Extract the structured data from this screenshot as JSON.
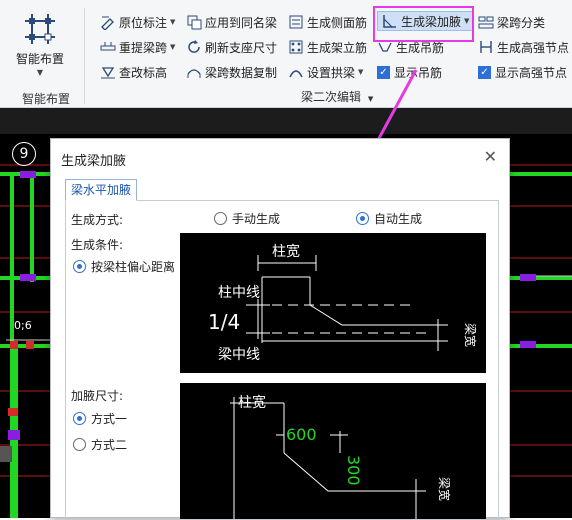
{
  "ribbon": {
    "layout_button": {
      "label": "智能布置",
      "icon": "grid-layout-icon"
    },
    "groups": {
      "layout": "智能布置",
      "beam_edit": "梁二次编辑"
    },
    "col1": [
      {
        "label": "原位标注",
        "icon": "annotate-icon",
        "dropdown": true
      },
      {
        "label": "重提梁跨",
        "icon": "span-icon",
        "dropdown": true
      },
      {
        "label": "查改标高",
        "icon": "elevation-icon"
      }
    ],
    "col2": [
      {
        "label": "应用到同名梁",
        "icon": "apply-icon"
      },
      {
        "label": "刷新支座尺寸",
        "icon": "refresh-icon"
      },
      {
        "label": "梁跨数据复制",
        "icon": "copy-icon"
      }
    ],
    "col3": [
      {
        "label": "生成侧面筋",
        "icon": "side-rebar-icon"
      },
      {
        "label": "生成架立筋",
        "icon": "erect-rebar-icon"
      },
      {
        "label": "设置拱梁",
        "icon": "arch-icon",
        "dropdown": true
      }
    ],
    "col4": [
      {
        "label": "生成梁加腋",
        "icon": "haunch-icon",
        "dropdown": true,
        "highlighted": true
      },
      {
        "label": "生成吊筋",
        "icon": "hanger-icon"
      },
      {
        "label": "显示吊筋",
        "checked": true
      }
    ],
    "col5": [
      {
        "label": "梁跨分类",
        "icon": "classify-icon"
      },
      {
        "label": "生成高强节点",
        "icon": "node-icon"
      },
      {
        "label": "显示高强节点",
        "checked": true
      }
    ]
  },
  "cad": {
    "axis_number": "9",
    "dim_label": "0;6"
  },
  "dialog": {
    "title": "生成梁加腋",
    "tab": "梁水平加腋",
    "method_label": "生成方式:",
    "method_options": [
      "手动生成",
      "自动生成"
    ],
    "method_selected": "自动生成",
    "condition_label": "生成条件:",
    "condition_option": "按梁柱偏心距离",
    "size_label": "加腋尺寸:",
    "size_options": [
      "方式一",
      "方式二"
    ],
    "size_selected": "方式一",
    "preview1": {
      "col_width": "柱宽",
      "col_center": "柱中线",
      "ratio": "1/4",
      "beam_center": "梁中线",
      "beam_width": "梁宽"
    },
    "preview2": {
      "col_width": "柱宽",
      "dim_h": "600",
      "dim_v": "300",
      "beam_width": "梁宽"
    }
  },
  "colors": {
    "accent": "#e43be6",
    "selection": "#cfe0f6",
    "green_dim": "#23d623",
    "cad_bg": "#000000"
  }
}
